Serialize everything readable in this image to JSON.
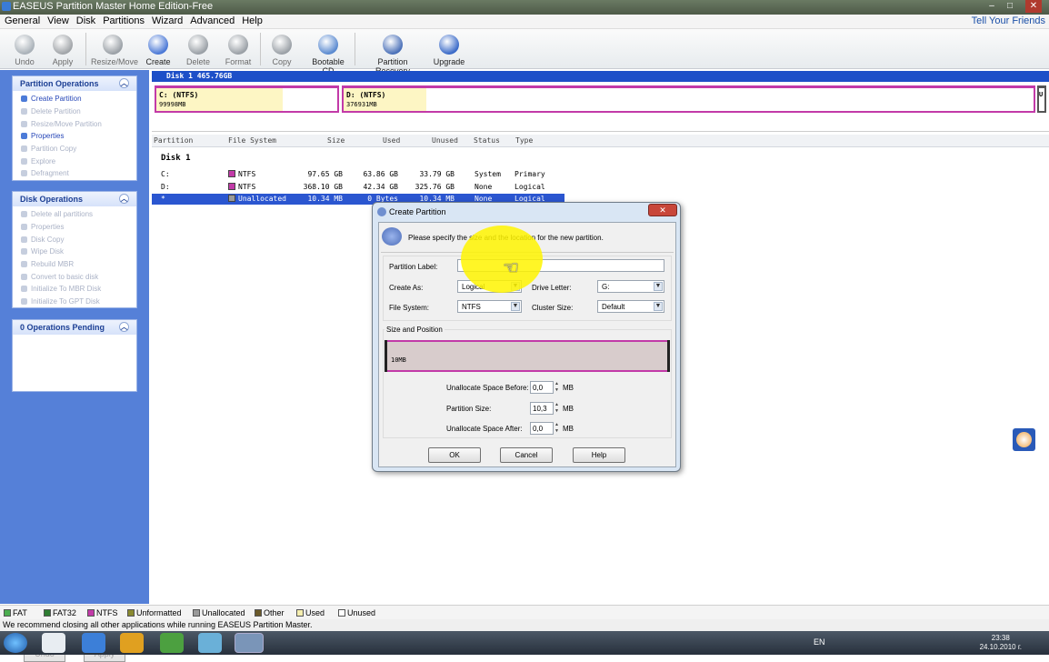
{
  "window": {
    "title": "EASEUS Partition Master Home Edition-Free",
    "min": "–",
    "max": "□",
    "close": "✕"
  },
  "menu": [
    "General",
    "View",
    "Disk",
    "Partitions",
    "Wizard",
    "Advanced",
    "Help"
  ],
  "tell_friends": "Tell Your Friends",
  "toolbar": [
    {
      "label": "Undo",
      "icon": "undo-icon",
      "enabled": false,
      "color": "#a9b1b8"
    },
    {
      "label": "Apply",
      "icon": "check-icon",
      "enabled": false,
      "color": "#a0a4a8"
    },
    {
      "label": "Resize/Move",
      "icon": "resize-move-icon",
      "enabled": false,
      "color": "#9aa0a6"
    },
    {
      "label": "Create",
      "icon": "create-icon",
      "enabled": true,
      "color": "#4a78d6"
    },
    {
      "label": "Delete",
      "icon": "delete-icon",
      "enabled": false,
      "color": "#9aa0a6"
    },
    {
      "label": "Format",
      "icon": "format-icon",
      "enabled": false,
      "color": "#9aa0a6"
    },
    {
      "label": "Copy",
      "icon": "copy-icon",
      "enabled": false,
      "color": "#9aa0a6"
    },
    {
      "label": "Bootable CD",
      "icon": "cd-icon",
      "enabled": true,
      "color": "#5a8ad0"
    },
    {
      "label": "Partition Recovery",
      "icon": "recovery-icon",
      "enabled": true,
      "color": "#4a70b8"
    },
    {
      "label": "Upgrade",
      "icon": "upgrade-icon",
      "enabled": true,
      "color": "#3a6ac8"
    }
  ],
  "partition_ops": {
    "title": "Partition Operations",
    "items": [
      {
        "label": "Create Partition",
        "enabled": true
      },
      {
        "label": "Delete Partition",
        "enabled": false
      },
      {
        "label": "Resize/Move Partition",
        "enabled": false
      },
      {
        "label": "Properties",
        "enabled": true
      },
      {
        "label": "Partition Copy",
        "enabled": false
      },
      {
        "label": "Explore",
        "enabled": false
      },
      {
        "label": "Defragment",
        "enabled": false
      }
    ]
  },
  "disk_ops": {
    "title": "Disk Operations",
    "items": [
      {
        "label": "Delete all partitions",
        "enabled": false
      },
      {
        "label": "Properties",
        "enabled": false
      },
      {
        "label": "Disk Copy",
        "enabled": false
      },
      {
        "label": "Wipe Disk",
        "enabled": false
      },
      {
        "label": "Rebuild MBR",
        "enabled": false
      },
      {
        "label": "Convert to basic disk",
        "enabled": false
      },
      {
        "label": "Initialize To MBR Disk",
        "enabled": false
      },
      {
        "label": "Initialize To GPT Disk",
        "enabled": false
      }
    ]
  },
  "pending": {
    "title": "0 Operations Pending"
  },
  "left_buttons": {
    "undo": "Undo",
    "apply": "Apply"
  },
  "disk_bar": "Disk 1  465.76GB",
  "disk_map": [
    {
      "name": "C: (NTFS)",
      "size": "99998MB"
    },
    {
      "name": "D: (NTFS)",
      "size": "376931MB"
    },
    {
      "name": "U"
    }
  ],
  "table": {
    "headers": [
      "Partition",
      "File System",
      "Size",
      "Used",
      "Unused",
      "Status",
      "Type"
    ],
    "group": "Disk 1",
    "rows": [
      [
        "C:",
        "NTFS",
        "97.65 GB",
        "63.86 GB",
        "33.79 GB",
        "System",
        "Primary"
      ],
      [
        "D:",
        "NTFS",
        "368.10 GB",
        "42.34 GB",
        "325.76 GB",
        "None",
        "Logical"
      ],
      [
        "*",
        "Unallocated",
        "10.34 MB",
        "0 Bytes",
        "10.34 MB",
        "None",
        "Logical"
      ]
    ]
  },
  "dialog": {
    "title": "Create Partition",
    "close": "✕",
    "instruction": "Please specify the size and the location for the new partition.",
    "partition_label": {
      "label": "Partition Label:",
      "value": ""
    },
    "create_as": {
      "label": "Create As:",
      "value": "Logical"
    },
    "drive_letter": {
      "label": "Drive Letter:",
      "value": "G:"
    },
    "file_system": {
      "label": "File System:",
      "value": "NTFS"
    },
    "cluster_size": {
      "label": "Cluster Size:",
      "value": "Default"
    },
    "size_position": "Size and Position",
    "bar_label": "10MB",
    "before": {
      "label": "Unallocate Space Before:",
      "value": "0,0",
      "unit": "MB"
    },
    "size": {
      "label": "Partition Size:",
      "value": "10,3",
      "unit": "MB"
    },
    "after": {
      "label": "Unallocate Space After:",
      "value": "0,0",
      "unit": "MB"
    },
    "ok": "OK",
    "cancel": "Cancel",
    "help": "Help"
  },
  "legend": [
    {
      "label": "FAT",
      "color": "#4caf50"
    },
    {
      "label": "FAT32",
      "color": "#2e7d32"
    },
    {
      "label": "NTFS",
      "color": "#c23aa8"
    },
    {
      "label": "Unformatted",
      "color": "#8a8a30"
    },
    {
      "label": "Unallocated",
      "color": "#9a9a9a"
    },
    {
      "label": "Other",
      "color": "#6b5a2a"
    },
    {
      "label": "Used",
      "color": "#f6efb0"
    },
    {
      "label": "Unused",
      "color": "#ffffff"
    }
  ],
  "status": "We recommend closing all other applications while running EASEUS Partition Master.",
  "taskbar": {
    "lang": "EN",
    "time": "23:38",
    "date": "24.10.2010 г."
  }
}
